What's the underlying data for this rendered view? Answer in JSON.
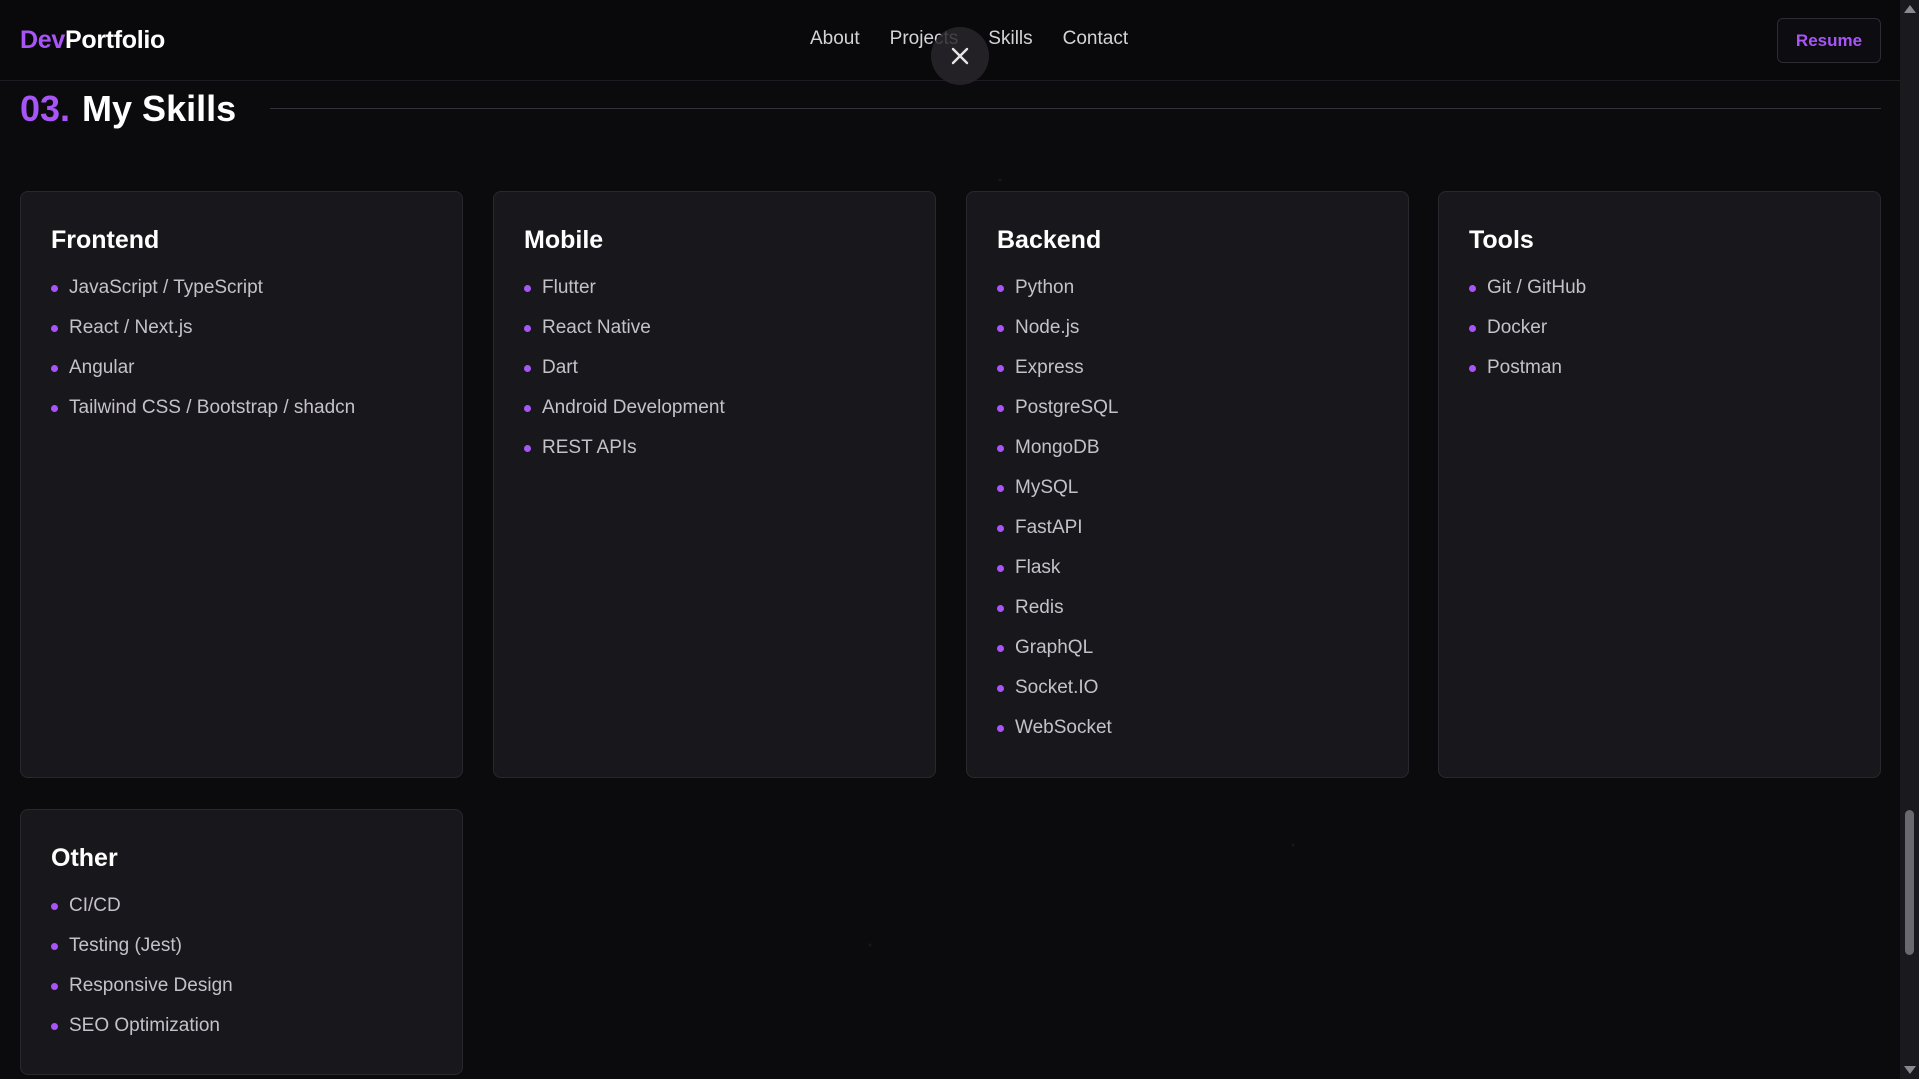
{
  "header": {
    "logo_accent": "Dev",
    "logo_rest": "Portfolio",
    "nav": [
      "About",
      "Projects",
      "Skills",
      "Contact"
    ],
    "resume_label": "Resume",
    "close_icon": "close-icon"
  },
  "section": {
    "number": "03.",
    "title": "My Skills"
  },
  "colors": {
    "accent": "#a855f7",
    "background": "#0b0a0d",
    "card": "#18171b"
  },
  "cards": [
    {
      "title": "Frontend",
      "items": [
        "JavaScript / TypeScript",
        "React / Next.js",
        "Angular",
        "Tailwind CSS / Bootstrap / shadcn"
      ]
    },
    {
      "title": "Mobile",
      "items": [
        "Flutter",
        "React Native",
        "Dart",
        "Android Development",
        "REST APIs"
      ]
    },
    {
      "title": "Backend",
      "items": [
        "Python",
        "Node.js",
        "Express",
        "PostgreSQL",
        "MongoDB",
        "MySQL",
        "FastAPI",
        "Flask",
        "Redis",
        "GraphQL",
        "Socket.IO",
        "WebSocket"
      ]
    },
    {
      "title": "Tools",
      "items": [
        "Git / GitHub",
        "Docker",
        "Postman"
      ]
    },
    {
      "title": "Other",
      "items": [
        "CI/CD",
        "Testing (Jest)",
        "Responsive Design",
        "SEO Optimization"
      ]
    }
  ]
}
